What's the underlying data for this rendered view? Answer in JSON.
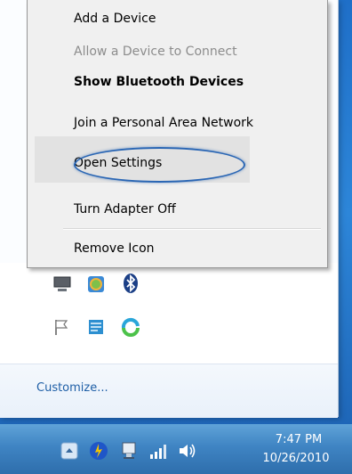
{
  "context_menu": {
    "items": [
      {
        "label": "Add a Device"
      },
      {
        "label": "Allow a Device to Connect"
      },
      {
        "label": "Show Bluetooth Devices"
      },
      {
        "label": "Join a Personal Area Network"
      },
      {
        "label": "Open Settings"
      },
      {
        "label": "Turn Adapter Off"
      },
      {
        "label": "Remove Icon"
      }
    ]
  },
  "tray_flyout": {
    "customize_label": "Customize...",
    "icons": [
      "monitor-icon",
      "network-globe-icon",
      "bluetooth-icon",
      "flag-icon",
      "notes-icon",
      "sync-icon"
    ]
  },
  "taskbar": {
    "clock": {
      "time": "7:47 PM",
      "date": "10/26/2010"
    },
    "icons": [
      "show-hidden-icons-arrow",
      "update-icon",
      "network-icon",
      "signal-bars-icon",
      "speaker-icon"
    ]
  },
  "colors": {
    "menu_bg": "#f0f0f0",
    "oval_highlight": "#2a66b4",
    "taskbar": "#3f84c3"
  }
}
